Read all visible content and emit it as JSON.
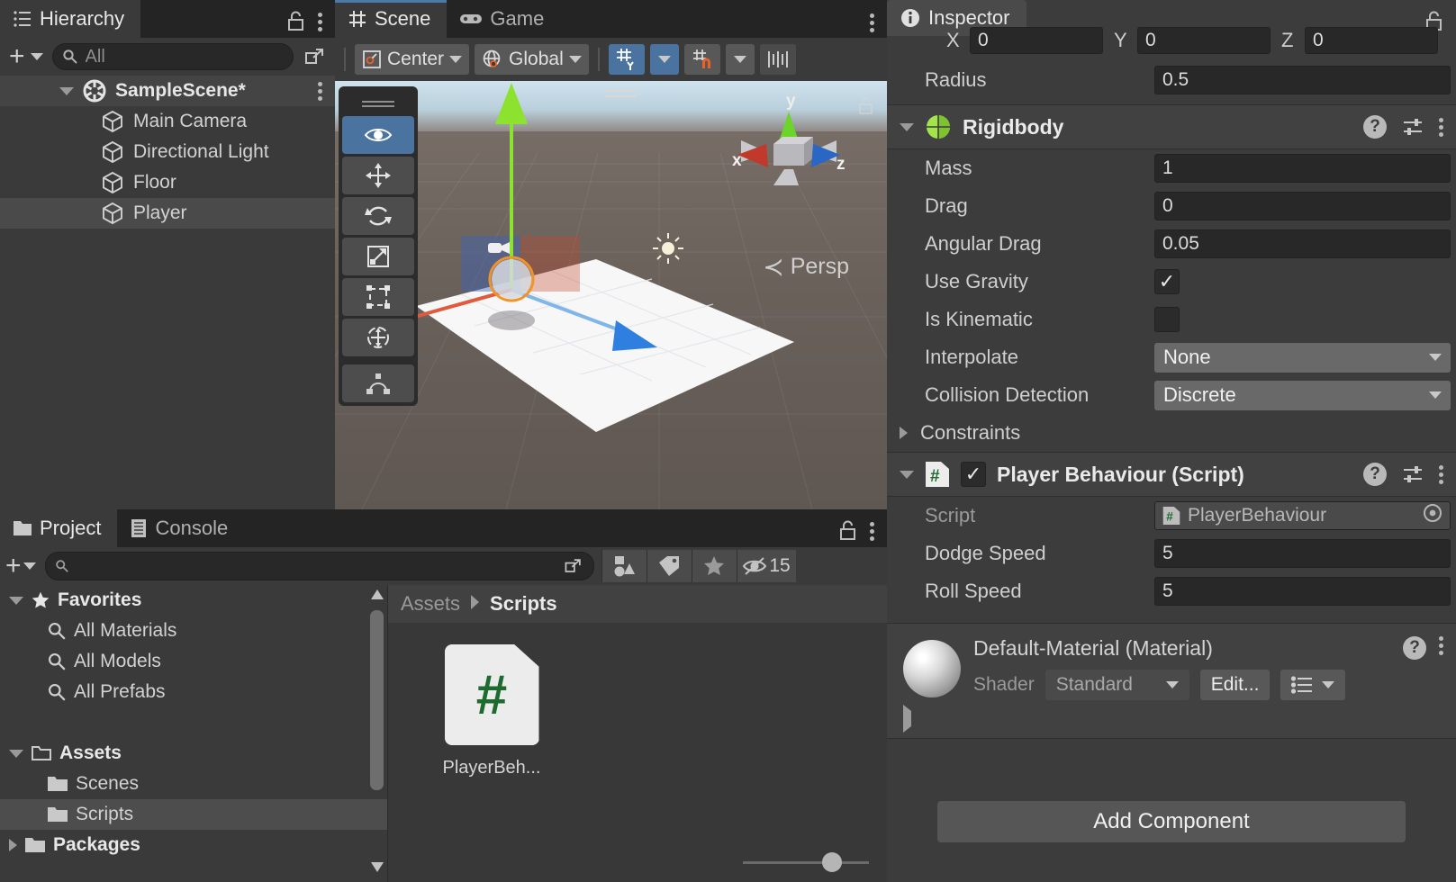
{
  "hierarchy": {
    "tab_label": "Hierarchy",
    "search_placeholder": "All",
    "search_value": "",
    "scene_name": "SampleScene*",
    "items": [
      {
        "label": "Main Camera",
        "selected": false
      },
      {
        "label": "Directional Light",
        "selected": false
      },
      {
        "label": "Floor",
        "selected": false
      },
      {
        "label": "Player",
        "selected": true
      }
    ]
  },
  "scene": {
    "tabs": [
      {
        "label": "Scene",
        "icon": "grid-icon",
        "active": true
      },
      {
        "label": "Game",
        "icon": "gamepad-icon",
        "active": false
      }
    ],
    "pivot_label": "Center",
    "handle_label": "Global",
    "tools": [
      "view-hand-icon",
      "move-icon",
      "rotate-icon",
      "scale-icon",
      "rect-transform-icon",
      "transform-icon",
      "custom-editor-icon"
    ],
    "active_tool_index": 0,
    "grid_axis_label": "Y",
    "camera_mode": "Persp",
    "gizmo_axes": {
      "x": "x",
      "y": "y",
      "z": "z"
    }
  },
  "project": {
    "tabs": [
      {
        "label": "Project",
        "icon": "folder-icon",
        "active": true
      },
      {
        "label": "Console",
        "icon": "console-icon",
        "active": false
      }
    ],
    "search_value": "",
    "search_placeholder": "",
    "hidden_count": "15",
    "tree": [
      {
        "label": "Favorites",
        "icon": "star-icon",
        "depth": 0,
        "bold": true,
        "expanded": true,
        "selected": false
      },
      {
        "label": "All Materials",
        "icon": "search-icon",
        "depth": 1,
        "bold": false,
        "selected": false
      },
      {
        "label": "All Models",
        "icon": "search-icon",
        "depth": 1,
        "bold": false,
        "selected": false
      },
      {
        "label": "All Prefabs",
        "icon": "search-icon",
        "depth": 1,
        "bold": false,
        "selected": false
      },
      {
        "label": "",
        "icon": "",
        "depth": 0,
        "bold": false,
        "selected": false
      },
      {
        "label": "Assets",
        "icon": "folder-open-icon",
        "depth": 0,
        "bold": true,
        "expanded": true,
        "selected": false
      },
      {
        "label": "Scenes",
        "icon": "folder-icon",
        "depth": 1,
        "bold": false,
        "selected": false
      },
      {
        "label": "Scripts",
        "icon": "folder-icon",
        "depth": 1,
        "bold": false,
        "selected": true
      },
      {
        "label": "Packages",
        "icon": "folder-icon",
        "depth": 0,
        "bold": true,
        "expanded": false,
        "selected": false
      }
    ],
    "breadcrumb": [
      "Assets",
      "Scripts"
    ],
    "assets": [
      {
        "label": "PlayerBeh...",
        "icon": "csharp-script-icon",
        "glyph": "#"
      }
    ]
  },
  "inspector": {
    "tab_label": "Inspector",
    "collider_tail": {
      "axes": [
        {
          "axis": "X",
          "value": "0"
        },
        {
          "axis": "Y",
          "value": "0"
        },
        {
          "axis": "Z",
          "value": "0"
        }
      ],
      "radius_label": "Radius",
      "radius_value": "0.5"
    },
    "rigidbody": {
      "title": "Rigidbody",
      "icon": "rigidbody-icon",
      "expanded": true,
      "fields": [
        {
          "label": "Mass",
          "type": "text",
          "value": "1"
        },
        {
          "label": "Drag",
          "type": "text",
          "value": "0"
        },
        {
          "label": "Angular Drag",
          "type": "text",
          "value": "0.05"
        },
        {
          "label": "Use Gravity",
          "type": "checkbox",
          "checked": true
        },
        {
          "label": "Is Kinematic",
          "type": "checkbox",
          "checked": false
        },
        {
          "label": "Interpolate",
          "type": "dropdown",
          "value": "None"
        },
        {
          "label": "Collision Detection",
          "type": "dropdown",
          "value": "Discrete"
        },
        {
          "label": "Constraints",
          "type": "foldout",
          "value": ""
        }
      ]
    },
    "script_component": {
      "title": "Player Behaviour (Script)",
      "icon": "csharp-script-icon",
      "enabled": true,
      "expanded": true,
      "fields": [
        {
          "label": "Script",
          "type": "object",
          "value": "PlayerBehaviour"
        },
        {
          "label": "Dodge Speed",
          "type": "text",
          "value": "5"
        },
        {
          "label": "Roll Speed",
          "type": "text",
          "value": "5"
        }
      ]
    },
    "material": {
      "title": "Default-Material (Material)",
      "shader_label": "Shader",
      "shader_value": "Standard",
      "edit_label": "Edit..."
    },
    "add_component_label": "Add Component"
  },
  "colors": {
    "panel_bg": "#3a3a3a",
    "inspector_bg": "#3c3c3c",
    "tabstrip_bg": "#242424",
    "accent_blue": "#4a73a0",
    "selection": "#4d4d4d",
    "script_green": "#1d6b2e",
    "rigidbody_green": "#a3e34b",
    "axis_x": "#e05a3c",
    "axis_y": "#8ce22e",
    "axis_z": "#3b7fd4",
    "snap_orange": "#e8622a"
  }
}
